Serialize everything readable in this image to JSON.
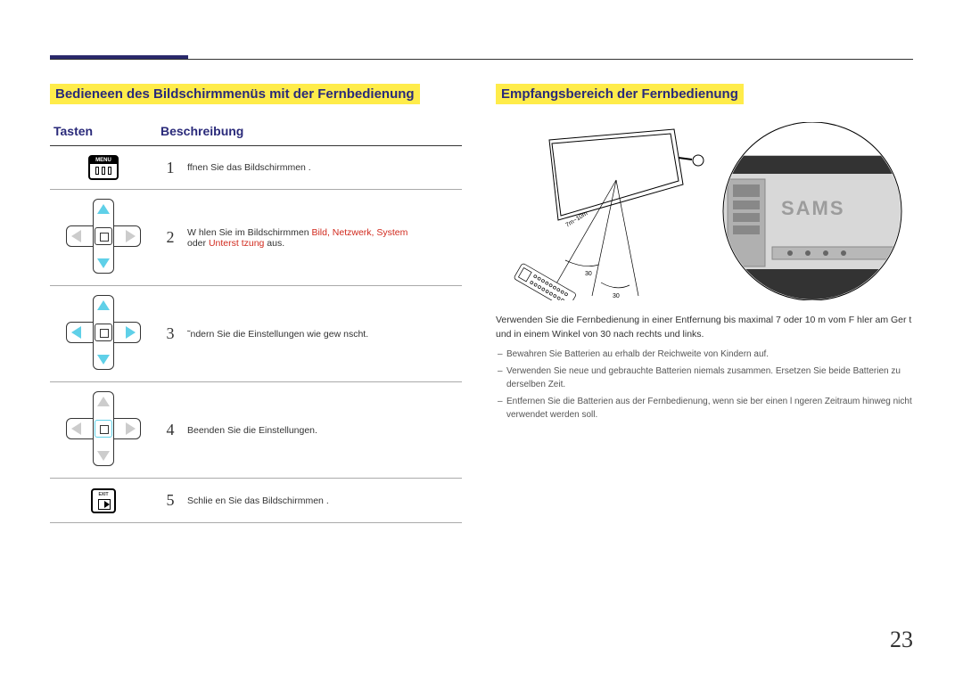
{
  "page_number": "23",
  "left": {
    "title": "Bedieneen des Bildschirmmenüs mit der Fernbedienung",
    "th_buttons": "Tasten",
    "th_desc": "Beschreibung",
    "rows": {
      "r1": {
        "num": "1",
        "desc": "ffnen Sie das Bildschirmmen ."
      },
      "r2": {
        "num": "2",
        "desc_a": "W hlen Sie im Bildschirmmen ",
        "desc_red1": "Bild, Netzwerk, System",
        "desc_b": "oder ",
        "desc_red2": "Unterst tzung",
        "desc_c": " aus."
      },
      "r3": {
        "num": "3",
        "desc": "˜ndern Sie die Einstellungen wie gew nscht."
      },
      "r4": {
        "num": "4",
        "desc": "Beenden Sie die Einstellungen."
      },
      "r5": {
        "num": "5",
        "desc": "Schlie en Sie das Bildschirmmen ."
      }
    },
    "menu_label": "MENU",
    "exit_label": "EXIT"
  },
  "right": {
    "title": "Empfangsbereich der Fernbedienung",
    "diagram": {
      "distance_label": "7m~10m",
      "angle_label_1": "30",
      "angle_label_2": "30",
      "brand_label": "SAMS"
    },
    "paragraph": "Verwenden Sie die Fernbedienung in einer Entfernung bis maximal 7 oder 10 m vom F hler am Ger t und in einem Winkel von 30 nach rechts und links.",
    "bullets": {
      "b1": "Bewahren Sie Batterien au erhalb der Reichweite von Kindern auf.",
      "b2": "Verwenden Sie neue und gebrauchte Batterien niemals zusammen. Ersetzen Sie beide Batterien zu derselben Zeit.",
      "b3": "Entfernen Sie die Batterien aus der Fernbedienung, wenn sie  ber einen l ngeren Zeitraum hinweg nicht verwendet werden soll."
    }
  }
}
